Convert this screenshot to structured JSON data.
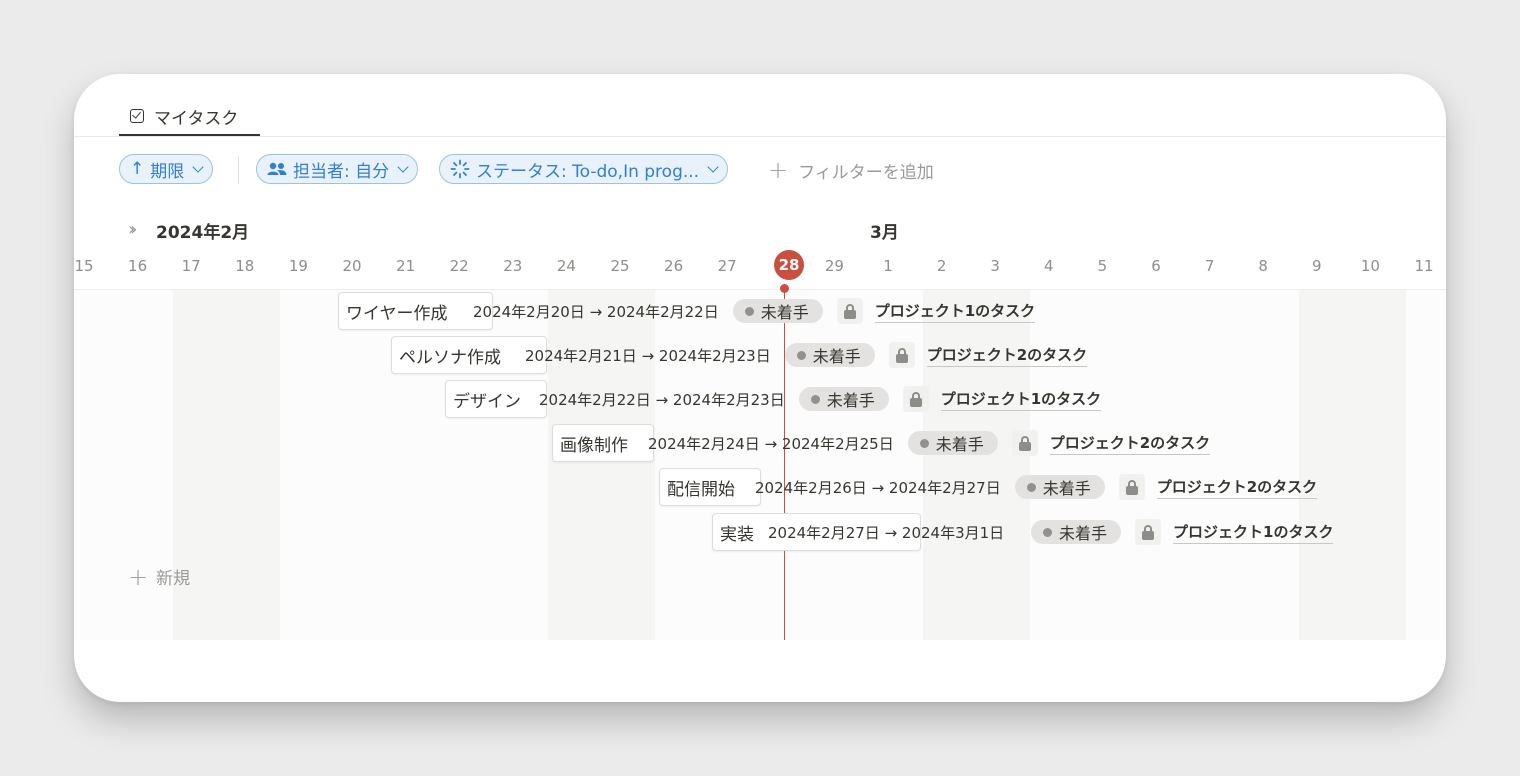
{
  "tab": {
    "label": "マイタスク"
  },
  "filters": {
    "sort_label": "期限",
    "assignee_label": "担当者: 自分",
    "status_label": "ステータス: To-do,In prog...",
    "add_filter_label": "フィルターを追加"
  },
  "timeline": {
    "month_feb": "2024年2月",
    "month_mar": "3月",
    "days": [
      "15",
      "16",
      "17",
      "18",
      "19",
      "20",
      "21",
      "22",
      "23",
      "24",
      "25",
      "26",
      "27",
      "28",
      "29",
      "1",
      "2",
      "3",
      "4",
      "5",
      "6",
      "7",
      "8",
      "9",
      "10",
      "11"
    ],
    "today": "28"
  },
  "tasks": [
    {
      "title": "ワイヤー作成",
      "dates": "2024年2月20日 → 2024年2月22日",
      "status": "未着手",
      "project": "プロジェクト1のタスク"
    },
    {
      "title": "ペルソナ作成",
      "dates": "2024年2月21日 → 2024年2月23日",
      "status": "未着手",
      "project": "プロジェクト2のタスク"
    },
    {
      "title": "デザイン",
      "dates": "2024年2月22日 → 2024年2月23日",
      "status": "未着手",
      "project": "プロジェクト1のタスク"
    },
    {
      "title": "画像制作",
      "dates": "2024年2月24日 → 2024年2月25日",
      "status": "未着手",
      "project": "プロジェクト2のタスク"
    },
    {
      "title": "配信開始",
      "dates": "2024年2月26日 → 2024年2月27日",
      "status": "未着手",
      "project": "プロジェクト2のタスク"
    },
    {
      "title": "実装",
      "dates": "2024年2月27日 → 2024年3月1日",
      "status": "未着手",
      "project": "プロジェクト1のタスク"
    }
  ],
  "new_label": "新規",
  "colors": {
    "accent": "#2f7fd6",
    "today": "#cb4f41",
    "status_bg": "#e3e2e0"
  }
}
